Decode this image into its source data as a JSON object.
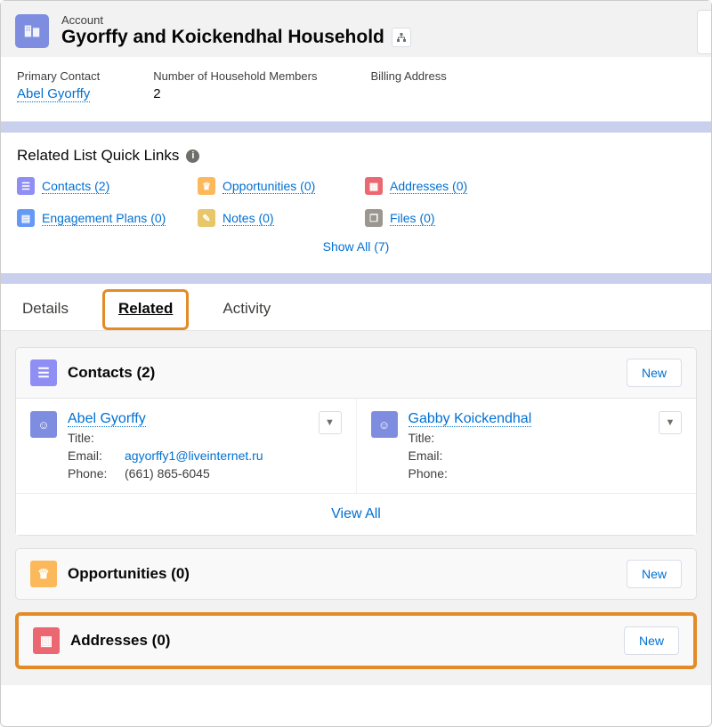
{
  "header": {
    "label": "Account",
    "title": "Gyorffy and Koickendhal Household"
  },
  "info": {
    "primaryContact": {
      "label": "Primary Contact",
      "value": "Abel Gyorffy"
    },
    "members": {
      "label": "Number of Household Members",
      "value": "2"
    },
    "billing": {
      "label": "Billing Address",
      "value": ""
    }
  },
  "quicklinks": {
    "title": "Related List Quick Links",
    "items": {
      "contacts": "Contacts (2)",
      "opportunities": "Opportunities (0)",
      "addresses": "Addresses (0)",
      "engagement": "Engagement Plans (0)",
      "notes": "Notes (0)",
      "files": "Files (0)"
    },
    "showAll": "Show All (7)"
  },
  "tabs": {
    "details": "Details",
    "related": "Related",
    "activity": "Activity"
  },
  "cards": {
    "contacts": {
      "title": "Contacts (2)",
      "new": "New",
      "viewAll": "View All",
      "items": [
        {
          "name": "Abel Gyorffy",
          "titleLabel": "Title:",
          "title": "",
          "emailLabel": "Email:",
          "email": "agyorffy1@liveinternet.ru",
          "phoneLabel": "Phone:",
          "phone": "(661) 865-6045"
        },
        {
          "name": "Gabby Koickendhal",
          "titleLabel": "Title:",
          "title": "",
          "emailLabel": "Email:",
          "email": "",
          "phoneLabel": "Phone:",
          "phone": ""
        }
      ]
    },
    "opportunities": {
      "title": "Opportunities (0)",
      "new": "New"
    },
    "addresses": {
      "title": "Addresses (0)",
      "new": "New"
    }
  }
}
